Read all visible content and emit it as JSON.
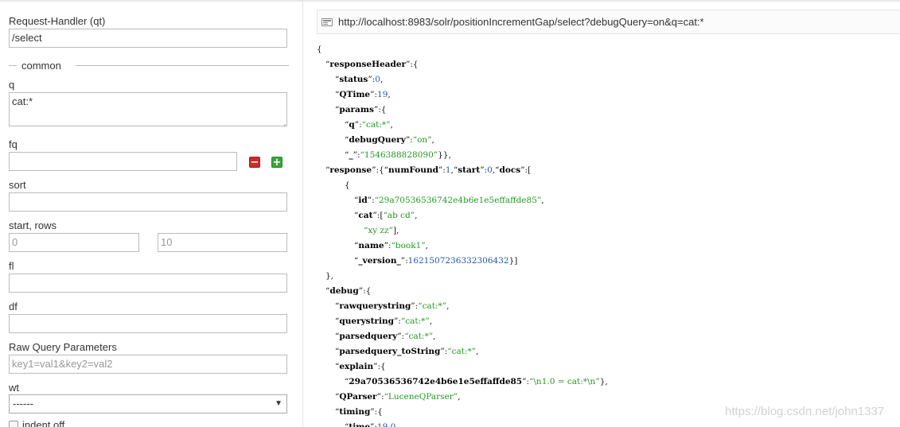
{
  "form": {
    "request_handler": {
      "label": "Request-Handler (qt)",
      "value": "/select"
    },
    "section_common": "common",
    "q": {
      "label": "q",
      "value": "cat:*"
    },
    "fq": {
      "label": "fq",
      "value": ""
    },
    "sort": {
      "label": "sort",
      "value": ""
    },
    "start_rows": {
      "label": "start, rows",
      "start": "0",
      "rows": "10"
    },
    "fl": {
      "label": "fl",
      "value": ""
    },
    "df": {
      "label": "df",
      "value": ""
    },
    "raw_params": {
      "label": "Raw Query Parameters",
      "placeholder": "key1=val1&key2=val2"
    },
    "wt": {
      "label": "wt",
      "selected": "------"
    },
    "indent": {
      "label": "indent off"
    }
  },
  "icons": {
    "remove": "−",
    "add": "+",
    "select_arrow": "▼"
  },
  "url": "http://localhost:8983/solr/positionIncrementGap/select?debugQuery=on&q=cat:*",
  "json_lines": [
    [
      {
        "t": "p",
        "v": "{"
      }
    ],
    [
      {
        "t": "p",
        "v": "“"
      },
      {
        "t": "k",
        "v": "responseHeader"
      },
      {
        "t": "p",
        "v": "”:{"
      }
    ],
    [
      {
        "t": "p",
        "v": "“"
      },
      {
        "t": "k",
        "v": "status"
      },
      {
        "t": "p",
        "v": "”:"
      },
      {
        "t": "n",
        "v": "0"
      },
      {
        "t": "p",
        "v": ","
      }
    ],
    [
      {
        "t": "p",
        "v": "“"
      },
      {
        "t": "k",
        "v": "QTime"
      },
      {
        "t": "p",
        "v": "”:"
      },
      {
        "t": "n",
        "v": "19"
      },
      {
        "t": "p",
        "v": ","
      }
    ],
    [
      {
        "t": "p",
        "v": "“"
      },
      {
        "t": "k",
        "v": "params"
      },
      {
        "t": "p",
        "v": "”:{"
      }
    ],
    [
      {
        "t": "p",
        "v": "“"
      },
      {
        "t": "k",
        "v": "q"
      },
      {
        "t": "p",
        "v": "”:"
      },
      {
        "t": "s",
        "v": "“cat:*”"
      },
      {
        "t": "p",
        "v": ","
      }
    ],
    [
      {
        "t": "p",
        "v": "“"
      },
      {
        "t": "k",
        "v": "debugQuery"
      },
      {
        "t": "p",
        "v": "”:"
      },
      {
        "t": "s",
        "v": "“on”"
      },
      {
        "t": "p",
        "v": ","
      }
    ],
    [
      {
        "t": "p",
        "v": "“"
      },
      {
        "t": "k",
        "v": "_"
      },
      {
        "t": "p",
        "v": "”:"
      },
      {
        "t": "s",
        "v": "“1546388828090”"
      },
      {
        "t": "p",
        "v": "}},"
      }
    ],
    [
      {
        "t": "p",
        "v": "“"
      },
      {
        "t": "k",
        "v": "response"
      },
      {
        "t": "p",
        "v": "”:{“"
      },
      {
        "t": "k",
        "v": "numFound"
      },
      {
        "t": "p",
        "v": "”:"
      },
      {
        "t": "n",
        "v": "1"
      },
      {
        "t": "p",
        "v": ",“"
      },
      {
        "t": "k",
        "v": "start"
      },
      {
        "t": "p",
        "v": "”:"
      },
      {
        "t": "n",
        "v": "0"
      },
      {
        "t": "p",
        "v": ",“"
      },
      {
        "t": "k",
        "v": "docs"
      },
      {
        "t": "p",
        "v": "”:["
      }
    ],
    [
      {
        "t": "p",
        "v": "{"
      }
    ],
    [
      {
        "t": "p",
        "v": "“"
      },
      {
        "t": "k",
        "v": "id"
      },
      {
        "t": "p",
        "v": "”:"
      },
      {
        "t": "s",
        "v": "“29a70536536742e4b6e1e5effaffde85”"
      },
      {
        "t": "p",
        "v": ","
      }
    ],
    [
      {
        "t": "p",
        "v": "“"
      },
      {
        "t": "k",
        "v": "cat"
      },
      {
        "t": "p",
        "v": "”:["
      },
      {
        "t": "s",
        "v": "“ab cd”"
      },
      {
        "t": "p",
        "v": ","
      }
    ],
    [
      {
        "t": "s",
        "v": "“xy zz”"
      },
      {
        "t": "p",
        "v": "],"
      }
    ],
    [
      {
        "t": "p",
        "v": "“"
      },
      {
        "t": "k",
        "v": "name"
      },
      {
        "t": "p",
        "v": "”:"
      },
      {
        "t": "s",
        "v": "“book1”"
      },
      {
        "t": "p",
        "v": ","
      }
    ],
    [
      {
        "t": "p",
        "v": "“"
      },
      {
        "t": "k",
        "v": "_version_"
      },
      {
        "t": "p",
        "v": "”:"
      },
      {
        "t": "n",
        "v": "1621507236332306432"
      },
      {
        "t": "p",
        "v": "}]"
      }
    ],
    [
      {
        "t": "p",
        "v": "},"
      }
    ],
    [
      {
        "t": "p",
        "v": "“"
      },
      {
        "t": "k",
        "v": "debug"
      },
      {
        "t": "p",
        "v": "”:{"
      }
    ],
    [
      {
        "t": "p",
        "v": "“"
      },
      {
        "t": "k",
        "v": "rawquerystring"
      },
      {
        "t": "p",
        "v": "”:"
      },
      {
        "t": "s",
        "v": "“cat:*”"
      },
      {
        "t": "p",
        "v": ","
      }
    ],
    [
      {
        "t": "p",
        "v": "“"
      },
      {
        "t": "k",
        "v": "querystring"
      },
      {
        "t": "p",
        "v": "”:"
      },
      {
        "t": "s",
        "v": "“cat:*”"
      },
      {
        "t": "p",
        "v": ","
      }
    ],
    [
      {
        "t": "p",
        "v": "“"
      },
      {
        "t": "k",
        "v": "parsedquery"
      },
      {
        "t": "p",
        "v": "”:"
      },
      {
        "t": "s",
        "v": "“cat:*”"
      },
      {
        "t": "p",
        "v": ","
      }
    ],
    [
      {
        "t": "p",
        "v": "“"
      },
      {
        "t": "k",
        "v": "parsedquery_toString"
      },
      {
        "t": "p",
        "v": "”:"
      },
      {
        "t": "s",
        "v": "“cat:*”"
      },
      {
        "t": "p",
        "v": ","
      }
    ],
    [
      {
        "t": "p",
        "v": "“"
      },
      {
        "t": "k",
        "v": "explain"
      },
      {
        "t": "p",
        "v": "”:{"
      }
    ],
    [
      {
        "t": "p",
        "v": "“"
      },
      {
        "t": "k",
        "v": "29a70536536742e4b6e1e5effaffde85"
      },
      {
        "t": "p",
        "v": "”:"
      },
      {
        "t": "s",
        "v": "“\\n1.0 = cat:*\\n”"
      },
      {
        "t": "p",
        "v": "},"
      }
    ],
    [
      {
        "t": "p",
        "v": "“"
      },
      {
        "t": "k",
        "v": "QParser"
      },
      {
        "t": "p",
        "v": "”:"
      },
      {
        "t": "s",
        "v": "“LuceneQParser”"
      },
      {
        "t": "p",
        "v": ","
      }
    ],
    [
      {
        "t": "p",
        "v": "“"
      },
      {
        "t": "k",
        "v": "timing"
      },
      {
        "t": "p",
        "v": "”:{"
      }
    ],
    [
      {
        "t": "p",
        "v": "“"
      },
      {
        "t": "k",
        "v": "time"
      },
      {
        "t": "p",
        "v": "”:"
      },
      {
        "t": "n",
        "v": "19.0"
      },
      {
        "t": "p",
        "v": ","
      }
    ]
  ],
  "watermark": "https://blog.csdn.net/john1337",
  "colors": {
    "json_string": "#229922",
    "json_number": "#2255aa",
    "remove_button": "#cc2b2b",
    "add_button": "#3aa53a"
  }
}
